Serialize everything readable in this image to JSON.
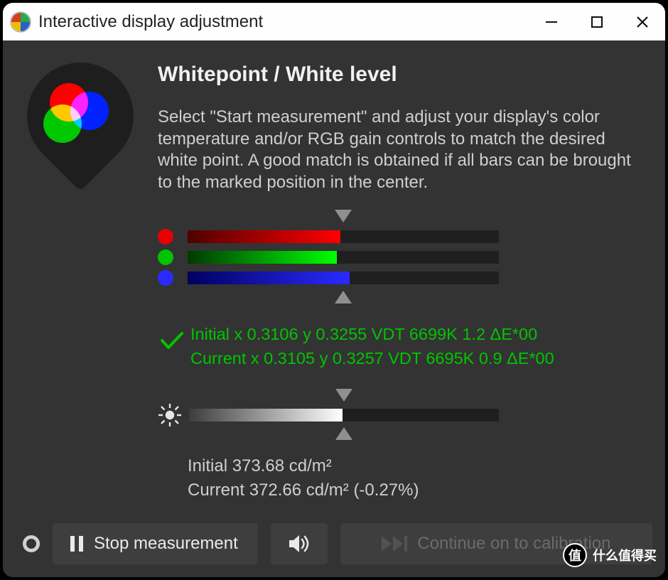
{
  "window": {
    "title": "Interactive display adjustment"
  },
  "header": {
    "title": "Whitepoint / White level",
    "description": "Select \"Start measurement\" and adjust your display's color temperature and/or RGB gain controls to match the desired white point. A good match is obtained if all bars can be brought to the marked position in the center."
  },
  "bars": {
    "red_percent": 49,
    "green_percent": 48,
    "blue_percent": 52
  },
  "whitepoint_status": {
    "initial_line": "Initial x 0.3106 y 0.3255 VDT 6699K 1.2 ΔE*00",
    "current_line": "Current x 0.3105 y 0.3257 VDT 6695K 0.9 ΔE*00"
  },
  "brightness": {
    "bar_percent": 49.5,
    "initial_line": "Initial 373.68 cd/m²",
    "current_line": "Current 372.66 cd/m² (-0.27%)"
  },
  "buttons": {
    "stop_label": "Stop measurement",
    "continue_label": "Continue on to calibration"
  },
  "watermark": {
    "circle": "值",
    "text": "什么值得买"
  }
}
